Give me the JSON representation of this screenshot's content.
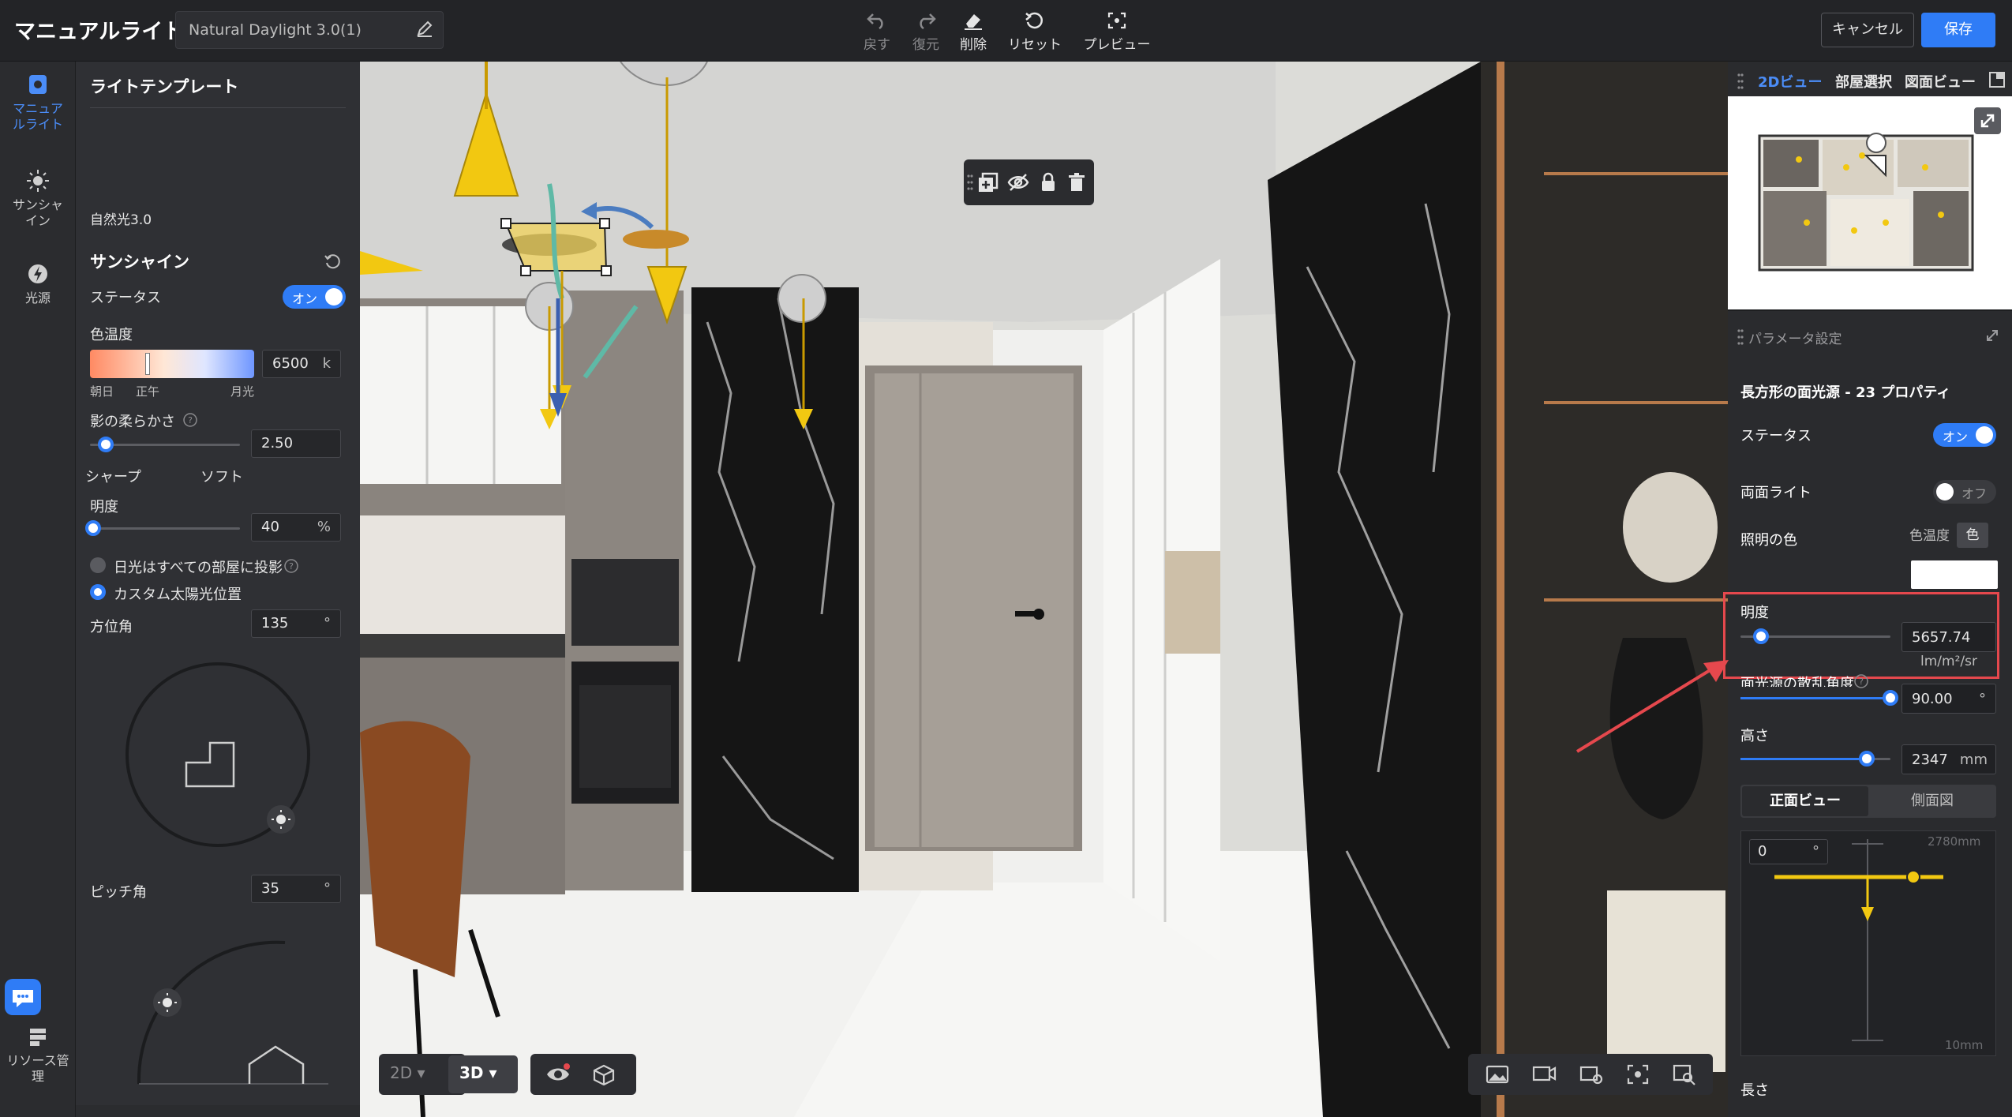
{
  "app": {
    "title": "マニュアルライト",
    "template_name": "Natural Daylight 3.0(1)"
  },
  "toolbar": {
    "undo": "戻す",
    "redo": "復元",
    "delete": "削除",
    "reset": "リセット",
    "preview": "プレビュー",
    "cancel": "キャンセル",
    "save": "保存"
  },
  "rail": {
    "manual_light": "マニュア ルライト",
    "manual_light_l1": "マニュア",
    "manual_light_l2": "ルライト",
    "sunshine_l1": "サンシャ",
    "sunshine_l2": "イン",
    "light_source": "光源",
    "resource_l1": "リソース管",
    "resource_l2": "理"
  },
  "left_panel": {
    "template_heading": "ライトテンプレート",
    "template_item": "自然光3.0",
    "sunshine_heading": "サンシャイン",
    "status_label": "ステータス",
    "status_value": "オン",
    "color_temp_label": "色温度",
    "color_temp_value": "6500",
    "color_temp_unit": "k",
    "ct_marks": [
      "朝日",
      "正午",
      "月光"
    ],
    "shadow_softness_label": "影の柔らかさ",
    "shadow_softness_value": "2.50",
    "shadow_softness_level": 0.1,
    "shadow_min": "シャープ",
    "shadow_max": "ソフト",
    "brightness_label": "明度",
    "brightness_value": "40",
    "brightness_unit": "%",
    "radio_all_rooms": "日光はすべての部屋に投影",
    "radio_custom": "カスタム太陽光位置",
    "azimuth_label": "方位角",
    "azimuth_value": "135",
    "degree_unit": "°",
    "pitch_label": "ピッチ角",
    "pitch_value": "35"
  },
  "right_panel": {
    "tabs": [
      "2Dビュー",
      "部屋選択",
      "図面ビュー"
    ],
    "params_heading": "パラメータ設定",
    "object_title": "長方形の面光源 - 23 プロパティ",
    "status_label": "ステータス",
    "status_value": "オン",
    "double_sided_label": "両面ライト",
    "double_sided_value": "オフ",
    "light_color_label": "照明の色",
    "color_temp_tab": "色温度",
    "color_tab": "色",
    "light_color_hex": "#ffffff",
    "brightness_label": "明度",
    "brightness_value": "5657.74",
    "brightness_unit": "lm/m²/sr",
    "brightness_level": 0.15,
    "scatter_label": "面光源の散乱角度",
    "scatter_value": "90.00",
    "scatter_unit": "°",
    "scatter_level": 1.0,
    "height_label": "高さ",
    "height_value": "2347",
    "height_unit": "mm",
    "height_level": 0.84,
    "front_view": "正面ビュー",
    "side_view": "側面図",
    "diagram_angle": "0",
    "diagram_top": "2780mm",
    "diagram_bottom": "10mm",
    "length_label": "長さ"
  },
  "bottom": {
    "mode_2d": "2D",
    "mode_3d": "3D"
  },
  "colors": {
    "accent": "#2f7cf6",
    "highlight": "#e5484d",
    "gizmo_yellow": "#f2c811"
  }
}
